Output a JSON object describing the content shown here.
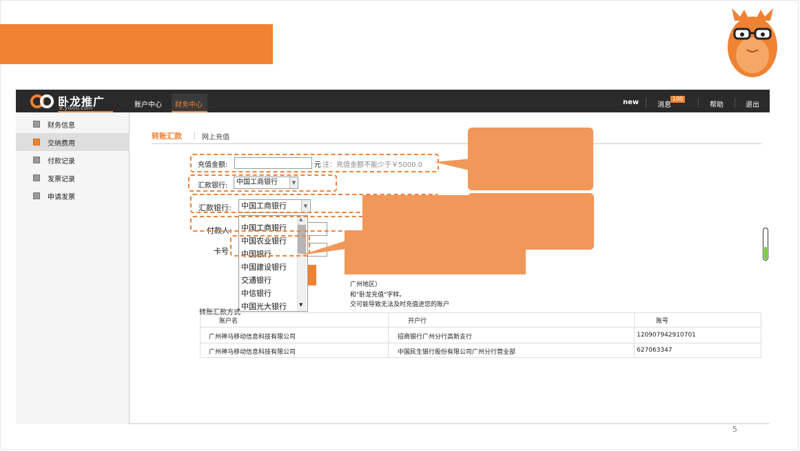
{
  "slide": {
    "page_number": "5"
  },
  "header": {
    "logo_text": "卧龙推广",
    "logo_sub": "e.yisou.com",
    "nav": [
      "账户中心",
      "财务中心"
    ],
    "right": {
      "new_label": "new",
      "messages_label": "消息",
      "messages_badge": "100",
      "help_label": "帮助",
      "logout_label": "退出"
    }
  },
  "sidebar": {
    "items": [
      {
        "label": "财务信息",
        "active": false
      },
      {
        "label": "交纳费用",
        "active": true
      },
      {
        "label": "付款记录",
        "active": false
      },
      {
        "label": "发票记录",
        "active": false
      },
      {
        "label": "申请发票",
        "active": false
      }
    ]
  },
  "tabs": {
    "active": "转账汇款",
    "other": "网上充值"
  },
  "form": {
    "amount_label": "充值金额:",
    "amount_value": "",
    "amount_unit": "元",
    "amount_note": "注：充值金额不能少于￥5000.0",
    "bank_label_1": "汇款银行:",
    "bank_value_1": "中国工商银行",
    "bank_label_2": "汇款银行:",
    "bank_value_2": "中国工商银行",
    "payer_label": "付款人:",
    "card_label": "卡号",
    "dropdown_options": [
      "中国工商银行",
      "中国农业银行",
      "中国银行",
      "中国建设银行",
      "交通银行",
      "中信银行",
      "中国光大银行"
    ],
    "dropdown_selected": "中国工商银行",
    "notes": [
      "广州地区）",
      "和\"卧龙充值\"字样。",
      "交可能导致无法及时充值进您的账户"
    ]
  },
  "transfer": {
    "section_title": "转账汇款方式",
    "columns": [
      "账户名",
      "开户行",
      "账号"
    ],
    "rows": [
      [
        "广州神马移动信息科技有限公司",
        "招商银行广州分行高新支行",
        "120907942910701"
      ],
      [
        "广州神马移动信息科技有限公司",
        "中国民生银行股份有限公司广州分行营业部",
        "627063347"
      ]
    ]
  },
  "colors": {
    "accent": "#ef8233",
    "callout": "#f0975a",
    "header_bg": "#2a2a2a"
  }
}
